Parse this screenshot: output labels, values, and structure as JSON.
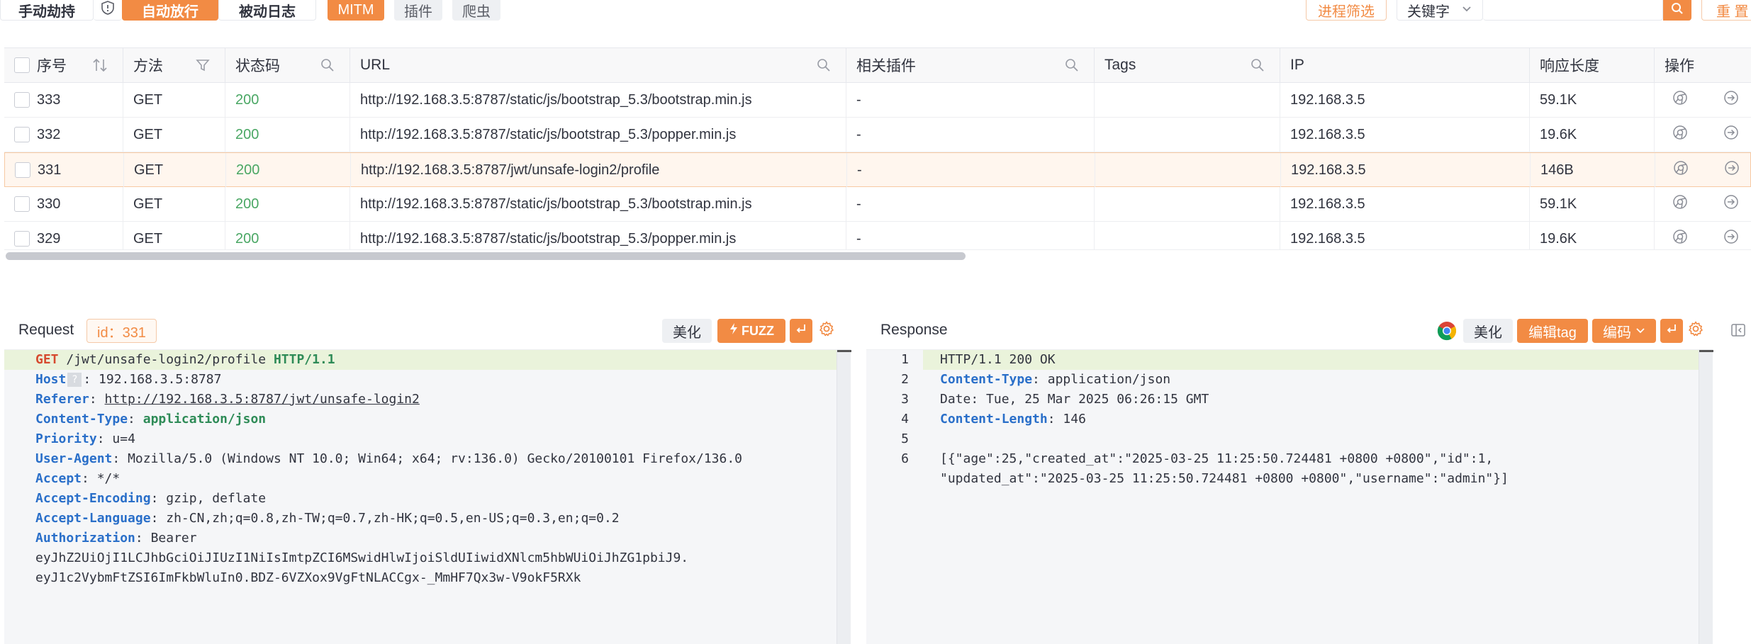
{
  "toolbar": {
    "manual_hijack": "手动劫持",
    "auto_release": "自动放行",
    "passive_log": "被动日志",
    "mitm": "MITM",
    "plugin": "插件",
    "crawler": "爬虫",
    "process_filter": "进程筛选",
    "keyword_select": "关键字",
    "search_placeholder": "",
    "reset": "重 置"
  },
  "table": {
    "columns": [
      "序号",
      "方法",
      "状态码",
      "URL",
      "相关插件",
      "Tags",
      "IP",
      "响应长度",
      "操作"
    ],
    "rows": [
      {
        "id": "333",
        "method": "GET",
        "status": "200",
        "url": "http://192.168.3.5:8787/static/js/bootstrap_5.3/bootstrap.min.js",
        "plugin": "-",
        "tags": "",
        "ip": "192.168.3.5",
        "length": "59.1K"
      },
      {
        "id": "332",
        "method": "GET",
        "status": "200",
        "url": "http://192.168.3.5:8787/static/js/bootstrap_5.3/popper.min.js",
        "plugin": "-",
        "tags": "",
        "ip": "192.168.3.5",
        "length": "19.6K"
      },
      {
        "id": "331",
        "method": "GET",
        "status": "200",
        "url": "http://192.168.3.5:8787/jwt/unsafe-login2/profile",
        "plugin": "-",
        "tags": "",
        "ip": "192.168.3.5",
        "length": "146B"
      },
      {
        "id": "330",
        "method": "GET",
        "status": "200",
        "url": "http://192.168.3.5:8787/static/js/bootstrap_5.3/bootstrap.min.js",
        "plugin": "-",
        "tags": "",
        "ip": "192.168.3.5",
        "length": "59.1K"
      },
      {
        "id": "329",
        "method": "GET",
        "status": "200",
        "url": "http://192.168.3.5:8787/static/js/bootstrap_5.3/popper.min.js",
        "plugin": "-",
        "tags": "",
        "ip": "192.168.3.5",
        "length": "19.6K"
      }
    ]
  },
  "request": {
    "title": "Request",
    "id_badge": "id：331",
    "beautify": "美化",
    "fuzz": "FUZZ",
    "request_line": {
      "method": "GET",
      "path": " /jwt/unsafe-login2/profile ",
      "version": "HTTP/1.1"
    },
    "headers": [
      {
        "name": "Host",
        "value": "192.168.3.5:8787"
      },
      {
        "name": "Referer",
        "value": "http://192.168.3.5:8787/jwt/unsafe-login2"
      },
      {
        "name": "Content-Type",
        "value": "application/json"
      },
      {
        "name": "Priority",
        "value": "u=4"
      },
      {
        "name": "User-Agent",
        "value": "Mozilla/5.0 (Windows NT 10.0; Win64; x64; rv:136.0) Gecko/20100101 Firefox/136.0"
      },
      {
        "name": "Accept",
        "value": "*/*"
      },
      {
        "name": "Accept-Encoding",
        "value": "gzip, deflate"
      },
      {
        "name": "Accept-Language",
        "value": "zh-CN,zh;q=0.8,zh-TW;q=0.7,zh-HK;q=0.5,en-US;q=0.3,en;q=0.2"
      },
      {
        "name": "Authorization",
        "value": "Bearer"
      }
    ],
    "token_line1": "eyJhZ2UiOjI1LCJhbGciOiJIUzI1NiIsImtpZCI6MSwidHlwIjoiSldUIiwidXNlcm5hbWUiOiJhZG1pbiJ9.",
    "token_line2": "eyJ1c2VybmFtZSI6ImFkbWluIn0.BDZ-6VZXox9VgFtNLACCgx-_MmHF7Qx3w-V9okF5RXk"
  },
  "response": {
    "title": "Response",
    "beautify": "美化",
    "edit_tag": "编辑tag",
    "encode": "编码",
    "line_numbers": [
      "1",
      "2",
      "3",
      "4",
      "5",
      "6"
    ],
    "status_line": "HTTP/1.1 200 OK",
    "content_type_name": "Content-Type",
    "content_type_value": "application/json",
    "date_line": "Date: Tue, 25 Mar 2025 06:26:15 GMT",
    "content_length_name": "Content-Length",
    "content_length_value": "146",
    "body_line1": "[{\"age\":25,\"created_at\":\"2025-03-25 11:25:50.724481 +0800 +0800\",\"id\":1,",
    "body_line2": "\"updated_at\":\"2025-03-25 11:25:50.724481 +0800 +0800\",\"username\":\"admin\"}]"
  },
  "colors": {
    "accent": "#f28b44",
    "status_ok": "#4aa764",
    "header_key": "#2a6fc9"
  }
}
